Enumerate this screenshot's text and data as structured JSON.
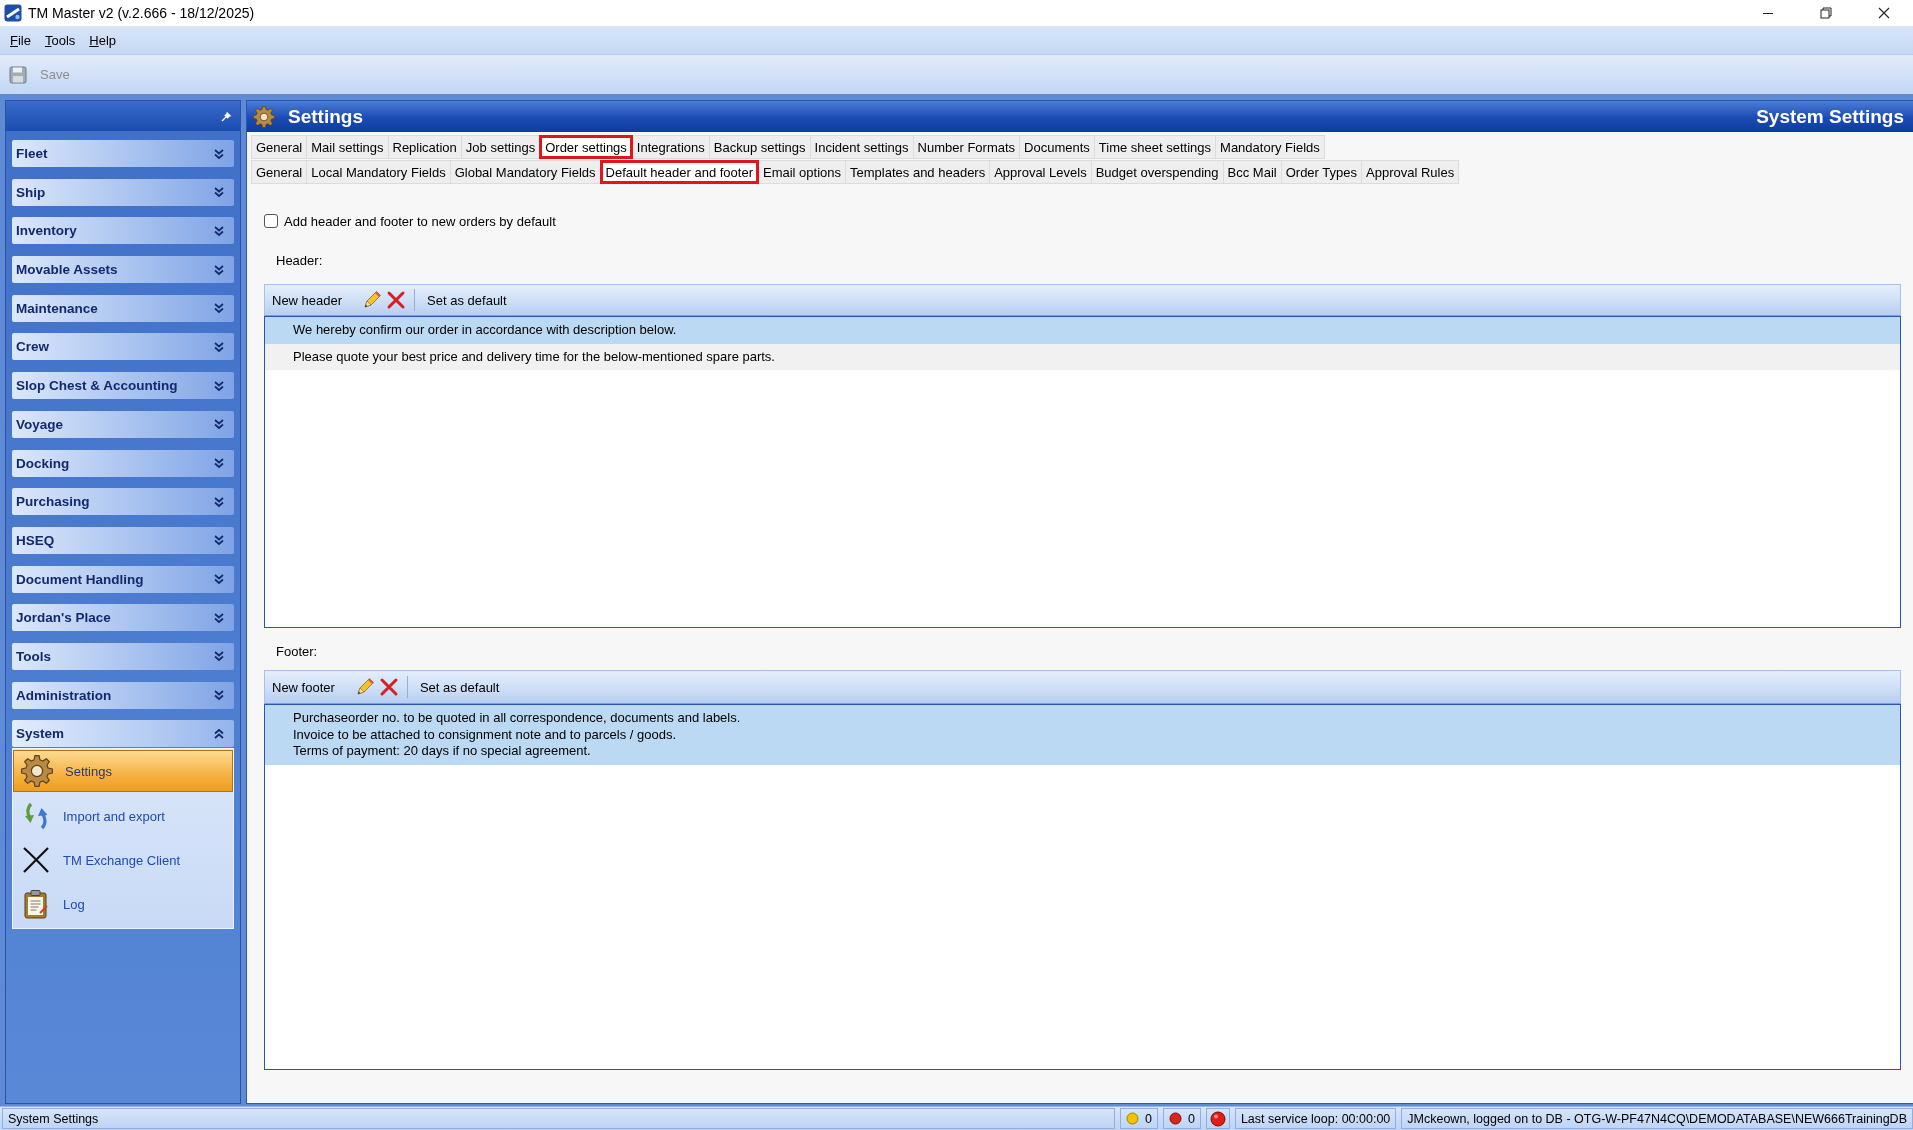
{
  "window": {
    "title": "TM Master v2 (v.2.666 - 18/12/2025)"
  },
  "menu": [
    {
      "label": "File"
    },
    {
      "label": "Tools"
    },
    {
      "label": "Help"
    }
  ],
  "toolbar": [
    {
      "label": "Save",
      "disabled": true
    }
  ],
  "sidebar": {
    "groups": [
      {
        "label": "Fleet",
        "expanded": false
      },
      {
        "label": "Ship",
        "expanded": false
      },
      {
        "label": "Inventory",
        "expanded": false
      },
      {
        "label": "Movable Assets",
        "expanded": false
      },
      {
        "label": "Maintenance",
        "expanded": false
      },
      {
        "label": "Crew",
        "expanded": false
      },
      {
        "label": "Slop Chest & Accounting",
        "expanded": false
      },
      {
        "label": "Voyage",
        "expanded": false
      },
      {
        "label": "Docking",
        "expanded": false
      },
      {
        "label": "Purchasing",
        "expanded": false
      },
      {
        "label": "HSEQ",
        "expanded": false
      },
      {
        "label": "Document Handling",
        "expanded": false
      },
      {
        "label": "Jordan's Place",
        "expanded": false
      },
      {
        "label": "Tools",
        "expanded": false
      },
      {
        "label": "Administration",
        "expanded": false
      },
      {
        "label": "System",
        "expanded": true,
        "items": [
          {
            "label": "Settings",
            "selected": true
          },
          {
            "label": "Import and export",
            "selected": false
          },
          {
            "label": "TM Exchange Client",
            "selected": false
          },
          {
            "label": "Log",
            "selected": false
          }
        ]
      }
    ]
  },
  "panel": {
    "title": "Settings",
    "context": "System Settings"
  },
  "tabs": [
    {
      "label": "General",
      "selected": false
    },
    {
      "label": "Mail settings",
      "selected": false
    },
    {
      "label": "Replication",
      "selected": false
    },
    {
      "label": "Job settings",
      "selected": false
    },
    {
      "label": "Order settings",
      "selected": true
    },
    {
      "label": "Integrations",
      "selected": false
    },
    {
      "label": "Backup settings",
      "selected": false
    },
    {
      "label": "Incident settings",
      "selected": false
    },
    {
      "label": "Number Formats",
      "selected": false
    },
    {
      "label": "Documents",
      "selected": false
    },
    {
      "label": "Time sheet settings",
      "selected": false
    },
    {
      "label": "Mandatory Fields",
      "selected": false
    }
  ],
  "subtabs": [
    {
      "label": "General",
      "selected": false
    },
    {
      "label": "Local Mandatory Fields",
      "selected": false
    },
    {
      "label": "Global Mandatory Fields",
      "selected": false
    },
    {
      "label": "Default header and footer",
      "selected": true
    },
    {
      "label": "Email options",
      "selected": false
    },
    {
      "label": "Templates and headers",
      "selected": false
    },
    {
      "label": "Approval Levels",
      "selected": false
    },
    {
      "label": "Budget overspending",
      "selected": false
    },
    {
      "label": "Bcc Mail",
      "selected": false
    },
    {
      "label": "Order Types",
      "selected": false
    },
    {
      "label": "Approval Rules",
      "selected": false
    }
  ],
  "checkbox": {
    "label": "Add header and footer to new orders by default",
    "checked": false
  },
  "header": {
    "label": "Header:",
    "new_button": "New header",
    "default_button": "Set as default",
    "rows": [
      {
        "text": "We hereby confirm our order in accordance with description below.",
        "selected": true
      },
      {
        "text": "Please quote your best price and delivery time for the below-mentioned spare parts.",
        "selected": false
      }
    ]
  },
  "footer": {
    "label": "Footer:",
    "new_button": "New footer",
    "default_button": "Set as default",
    "rows": [
      {
        "text": "Purchaseorder no. to be quoted in all correspondence, documents and labels.\nInvoice to be attached to consignment note and to parcels / goods.\nTerms of payment: 20 days if no special agreement.",
        "selected": true
      }
    ]
  },
  "status_bar": {
    "text": "System Settings",
    "warning_count": "0",
    "error_count": "0",
    "service_loop": "Last service loop: 00:00:00",
    "user": "JMckeown, logged on to DB - OTG-W-PF47N4CQ\\DEMODATABASE\\NEW666TrainingDB"
  }
}
